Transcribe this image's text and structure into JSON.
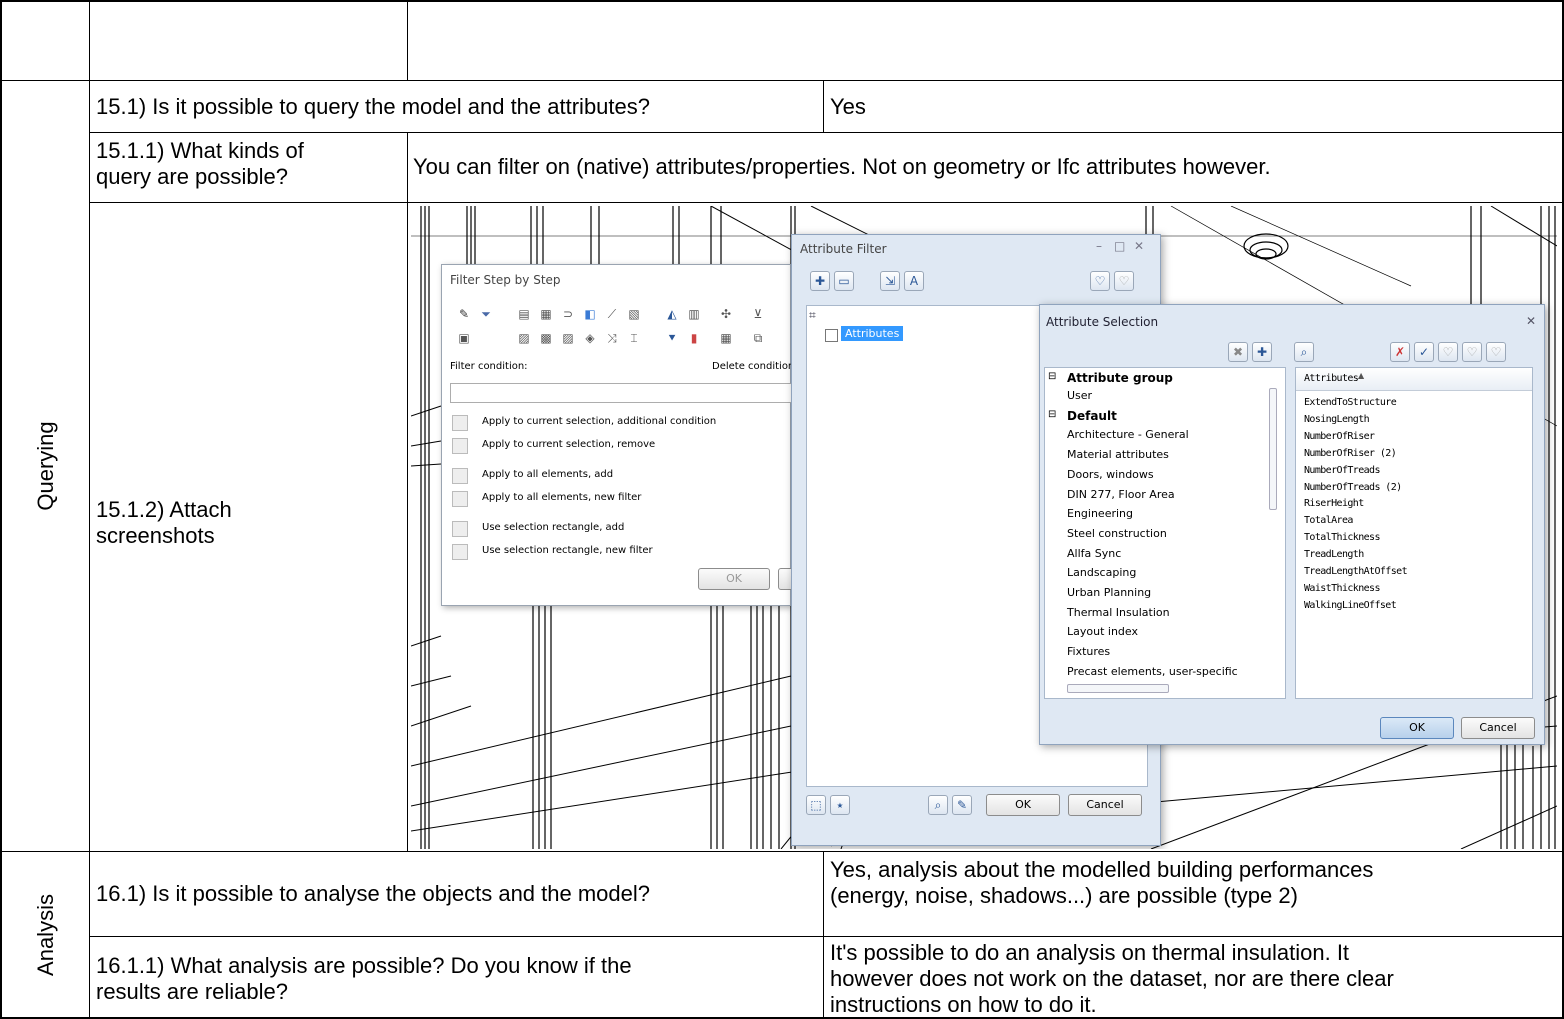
{
  "table": {
    "querying_label": "Querying",
    "analysis_label": "Analysis",
    "q15_1": "15.1) Is it possible to query the model and the attributes?",
    "q15_1_answer": "Yes",
    "q15_1_1_line1": "15.1.1) What kinds of",
    "q15_1_1_line2": "query are possible?",
    "q15_1_1_answer": "You can filter on (native) attributes/properties. Not on geometry or Ifc attributes however.",
    "q15_1_2_line1": "15.1.2) Attach",
    "q15_1_2_line2": "screenshots",
    "q16_1": "16.1) Is it possible to analyse the objects and the model?",
    "q16_1_answer_line1": "Yes, analysis about the modelled building performances",
    "q16_1_answer_line2": "(energy, noise, shadows...) are possible (type 2)",
    "q16_1_1_line1": "16.1.1) What analysis are possible? Do you know if the",
    "q16_1_1_line2": "results are reliable?",
    "q16_1_1_answer_line1": "It's possible to do an analysis on thermal insulation. It",
    "q16_1_1_answer_line2": "however does not work on the dataset, nor are there clear",
    "q16_1_1_answer_line3": "instructions on how to do it."
  },
  "filter_step": {
    "title": "Filter Step by Step",
    "filter_condition_label": "Filter condition:",
    "delete_condition_label": "Delete condition",
    "options": [
      "Apply to current selection, additional condition",
      "Apply to current selection, remove",
      "Apply to all elements, add",
      "Apply to all elements, new filter",
      "Use selection rectangle, add",
      "Use selection rectangle, new filter"
    ],
    "ok_label": "OK"
  },
  "attribute_filter": {
    "title": "Attribute Filter",
    "tree_item": "Attributes",
    "ok_label": "OK",
    "cancel_label": "Cancel"
  },
  "attribute_selection": {
    "title": "Attribute Selection",
    "group_header": "Attribute group",
    "groups": [
      {
        "label": "User",
        "bold": false
      },
      {
        "label": "Default",
        "bold": true
      },
      {
        "label": "Architecture - General",
        "bold": false
      },
      {
        "label": "Material attributes",
        "bold": false
      },
      {
        "label": "Doors, windows",
        "bold": false
      },
      {
        "label": "DIN 277, Floor Area",
        "bold": false
      },
      {
        "label": "Engineering",
        "bold": false
      },
      {
        "label": "Steel construction",
        "bold": false
      },
      {
        "label": "Allfa Sync",
        "bold": false
      },
      {
        "label": "Landscaping",
        "bold": false
      },
      {
        "label": "Urban Planning",
        "bold": false
      },
      {
        "label": "Thermal Insulation",
        "bold": false
      },
      {
        "label": "Layout index",
        "bold": false
      },
      {
        "label": "Fixtures",
        "bold": false
      },
      {
        "label": "Precast elements, user-specific",
        "bold": false
      }
    ],
    "attributes_header": "Attributes",
    "attributes": [
      "ExtendToStructure",
      "NosingLength",
      "NumberOfRiser",
      "NumberOfRiser (2)",
      "NumberOfTreads",
      "NumberOfTreads (2)",
      "RiserHeight",
      "TotalArea",
      "TotalThickness",
      "TreadLength",
      "TreadLengthAtOffset",
      "WaistThickness",
      "WalkingLineOffset"
    ],
    "ok_label": "OK",
    "cancel_label": "Cancel"
  }
}
